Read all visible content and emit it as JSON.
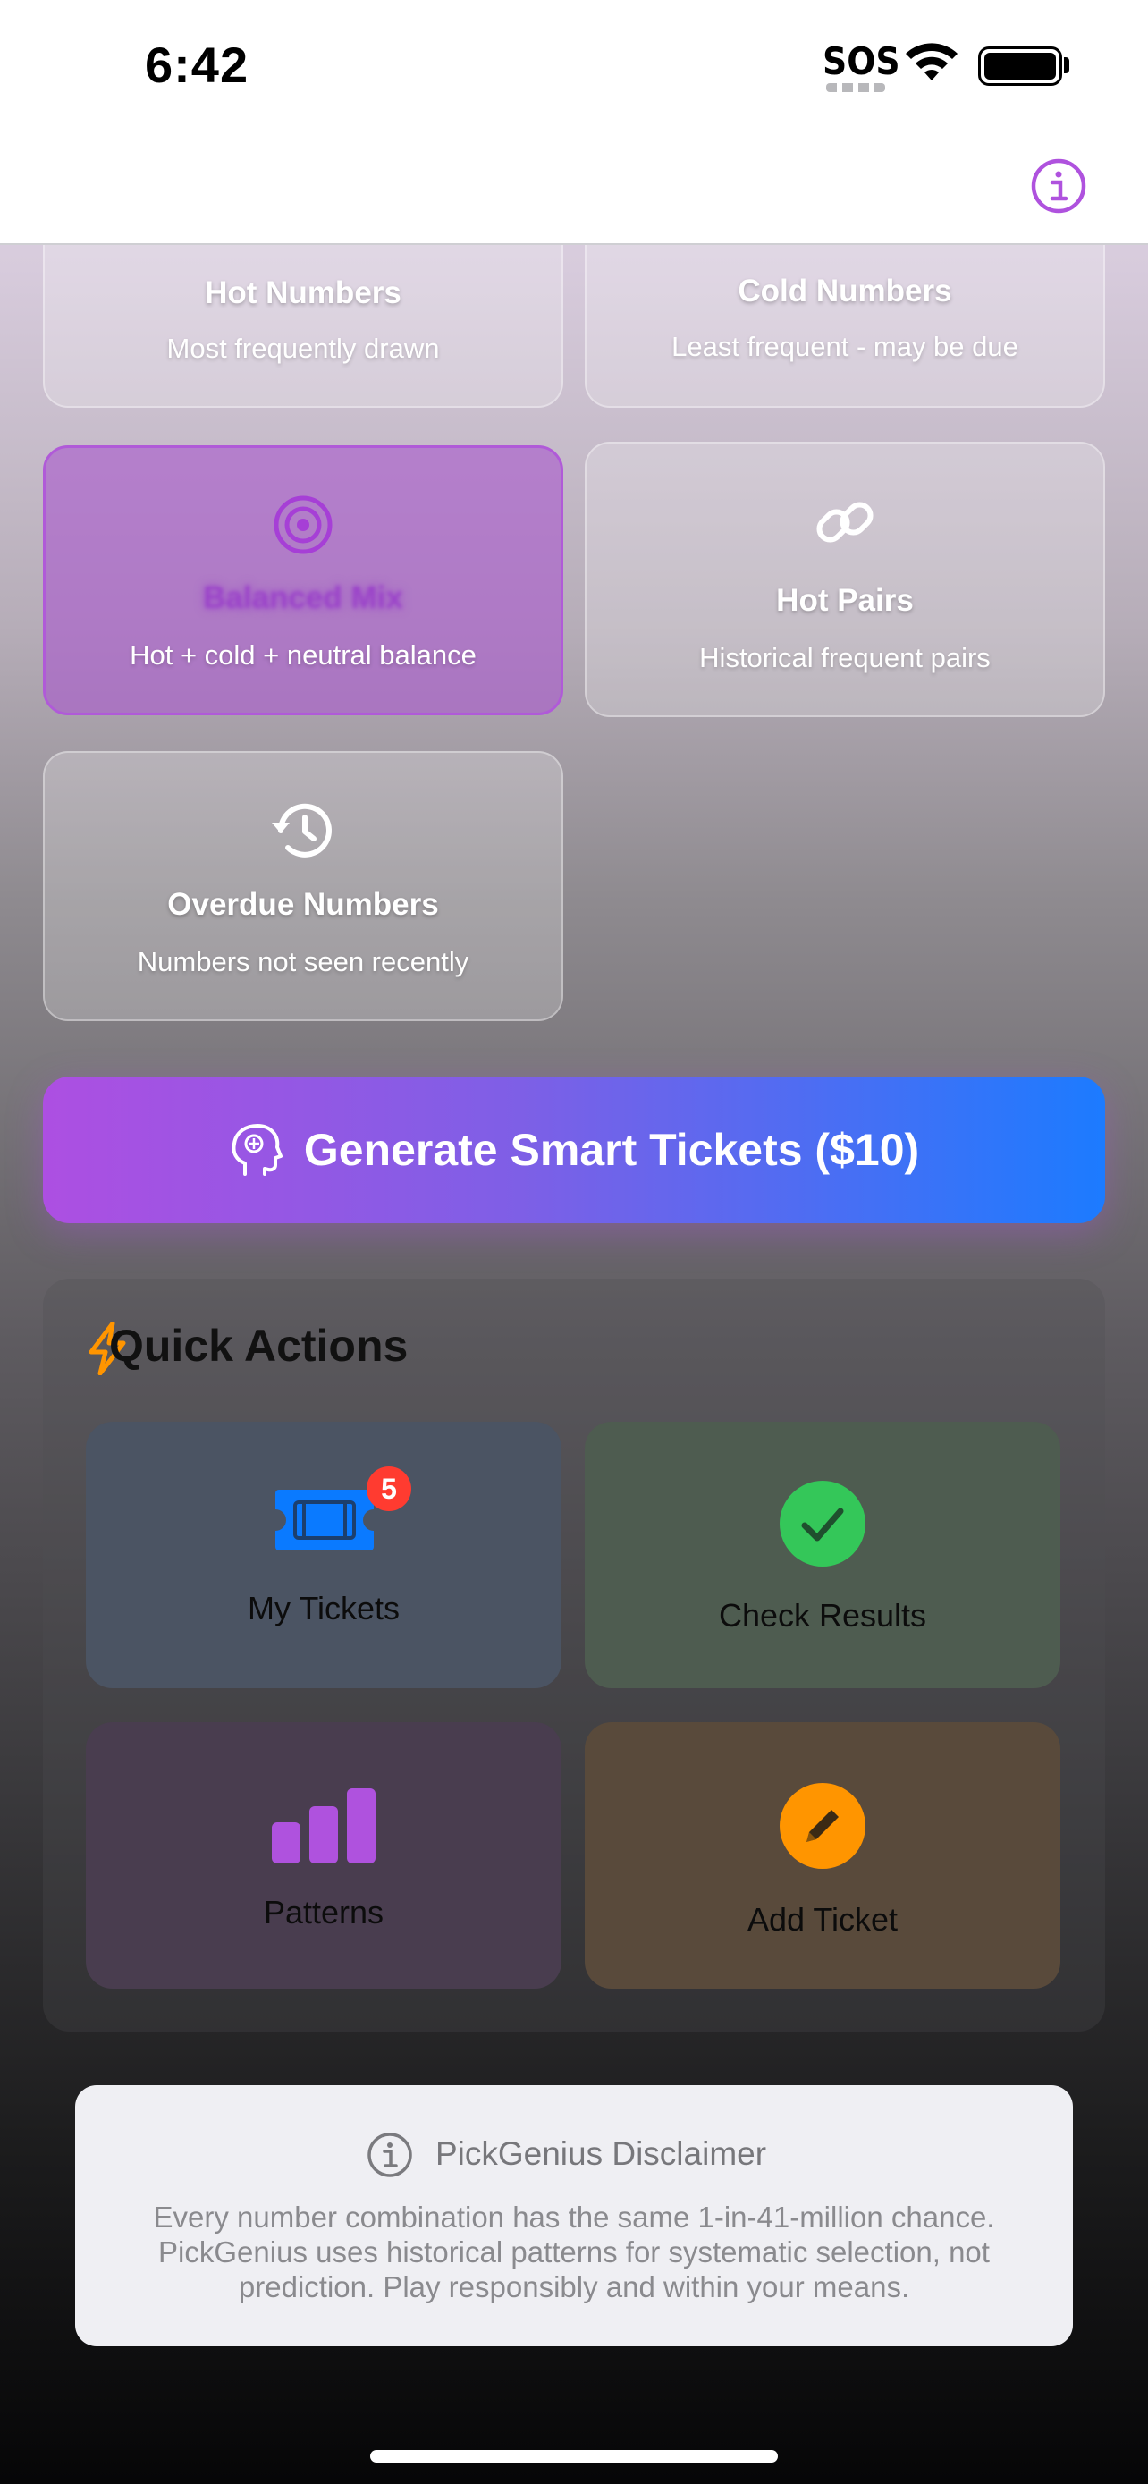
{
  "status_bar": {
    "time": "6:42",
    "sos": "SOS"
  },
  "strategies": [
    {
      "title": "Hot Numbers",
      "subtitle": "Most frequently drawn",
      "icon": "flame-icon"
    },
    {
      "title": "Cold Numbers",
      "subtitle": "Least frequent - may be due",
      "icon": "snowflake-icon"
    },
    {
      "title": "Balanced Mix",
      "subtitle": "Hot + cold + neutral balance",
      "icon": "target-icon",
      "selected": true
    },
    {
      "title": "Hot Pairs",
      "subtitle": "Historical frequent pairs",
      "icon": "link-icon"
    },
    {
      "title": "Overdue Numbers",
      "subtitle": "Numbers not seen recently",
      "icon": "clock-history-icon"
    }
  ],
  "generate_button": {
    "label": "Generate Smart Tickets ($10)",
    "icon": "brain-head-icon"
  },
  "quick_actions": {
    "title": "Quick Actions",
    "items": [
      {
        "label": "My Tickets",
        "badge": "5",
        "icon": "ticket-icon",
        "color": "#0a7aff"
      },
      {
        "label": "Check Results",
        "icon": "checkmark-circle-icon",
        "color": "#34c759"
      },
      {
        "label": "Patterns",
        "icon": "bar-chart-icon",
        "color": "#af52de"
      },
      {
        "label": "Add Ticket",
        "icon": "pencil-circle-icon",
        "color": "#ff9500"
      }
    ]
  },
  "disclaimer": {
    "title": "PickGenius Disclaimer",
    "body": "Every number combination has the same 1-in-41-million chance. PickGenius uses historical patterns for systematic selection, not prediction. Play responsibly and within your means."
  },
  "colors": {
    "accent": "#af52de",
    "blue": "#0a7aff",
    "green": "#34c759",
    "orange": "#ff9500",
    "badge": "#ff3b30"
  }
}
